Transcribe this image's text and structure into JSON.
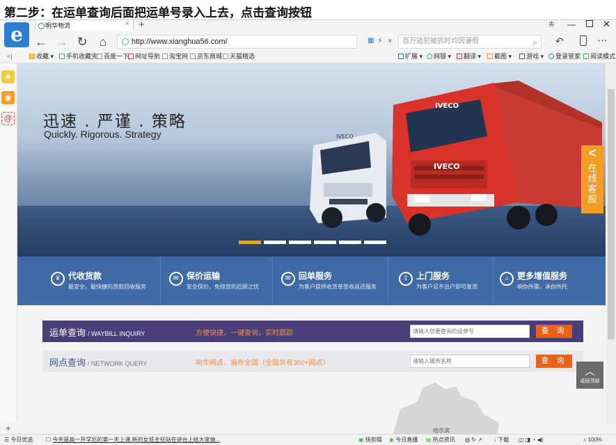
{
  "caption": "第二步：在运单查询后面把运单号录入上去，点击查询按钮",
  "browser": {
    "tab_title": "明华物流",
    "url": "http://www.xianghua56.com/",
    "search_placeholder": "百万逃犯被抓时均因瀑假",
    "bookmarks": [
      "收藏",
      "手机收藏夹",
      "百度一下",
      "网址导航",
      "淘宝网",
      "京东商城",
      "天猫精选"
    ],
    "toolbar_right": [
      "扩展",
      "网银",
      "翻译",
      "截图",
      "游戏",
      "登录管家",
      "阅读模式"
    ]
  },
  "banner": {
    "slogan_cn": "迅速 . 严谨 . 策略",
    "slogan_en": "Quickly. Rigorous. Strategy",
    "online_service": "在线客服",
    "truck_brand": "IVECO"
  },
  "services": [
    {
      "title": "代收货款",
      "desc": "最安全，最快捷的货款回收服务",
      "icon": "yen-icon"
    },
    {
      "title": "保价运输",
      "desc": "安全保价，免除您的后顾之忧",
      "icon": "envelope-icon"
    },
    {
      "title": "回单服务",
      "desc": "为客户提供收货单签收返还服务",
      "icon": "receipt-icon"
    },
    {
      "title": "上门服务",
      "desc": "为客户足不出户即可发货",
      "icon": "door-icon"
    },
    {
      "title": "更多增值服务",
      "desc": "响你所需，承你所托",
      "icon": "search-icon"
    }
  ],
  "waybill": {
    "title": "运单查询",
    "subtitle": "/ WAYBILL INQUIRY",
    "slogan": "方便快捷，一键查询，实时跟踪",
    "placeholder": "请输入您要查询的运单号",
    "button": "查 询"
  },
  "network": {
    "title": "网点查询",
    "subtitle": "/ NETWORK QUERY",
    "slogan": "响华网点，遍布全国（全国共有300+网点）",
    "placeholder": "请输入城市名称",
    "button": "查 询"
  },
  "map_label": "哈尔滨",
  "back_to_top": "返回顶部",
  "statusbar": {
    "left": "今日优选",
    "news": "今天是高一开学后的第一天上课,新的女班主任站在讲台上给大家做...",
    "items": [
      "快剪辑",
      "今日直播",
      "热点资讯",
      "下载"
    ],
    "zoom": "100%"
  },
  "colors": {
    "service_bar": "#3f6aa6",
    "waybill_bar": "#4a3e7a",
    "query_button": "#e8631a",
    "online_service": "#f39c28",
    "slide_active": "#e1a52a"
  }
}
